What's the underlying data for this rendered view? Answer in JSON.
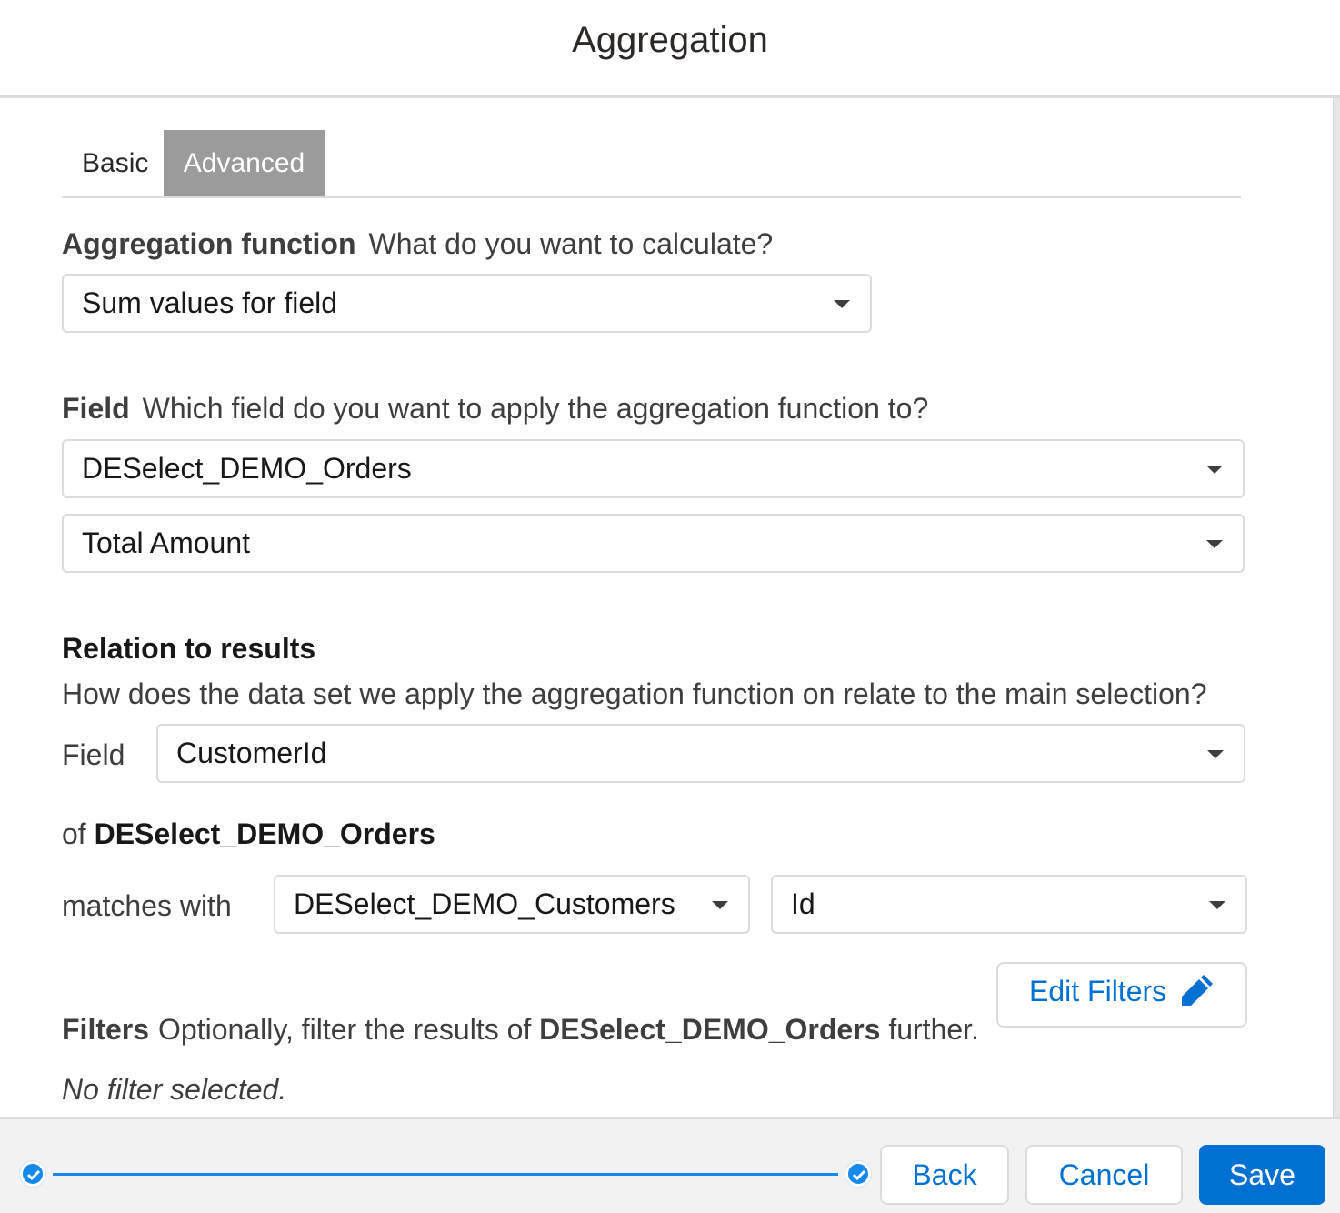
{
  "header": {
    "title": "Aggregation"
  },
  "tabs": [
    {
      "label": "Basic",
      "active": false
    },
    {
      "label": "Advanced",
      "active": true
    }
  ],
  "aggregation_function": {
    "label": "Aggregation function",
    "help": "What do you want to calculate?",
    "selected": "Sum values for field"
  },
  "field": {
    "label": "Field",
    "help": "Which field do you want to apply the aggregation function to?",
    "data_extension": "DESelect_DEMO_Orders",
    "field_name": "Total Amount"
  },
  "relation": {
    "title": "Relation to results",
    "help": "How does the data set we apply the aggregation function on relate to the main selection?",
    "field_label": "Field",
    "field_value": "CustomerId",
    "of_prefix": "of",
    "of_name": "DESelect_DEMO_Orders",
    "matches_label": "matches with",
    "match_data_extension": "DESelect_DEMO_Customers",
    "match_field": "Id"
  },
  "filters": {
    "label": "Filters",
    "help_prefix": "Optionally, filter the results of",
    "help_name": "DESelect_DEMO_Orders",
    "help_suffix": "further.",
    "status": "No filter selected.",
    "edit_label": "Edit Filters"
  },
  "footer": {
    "back_label": "Back",
    "cancel_label": "Cancel",
    "save_label": "Save",
    "progress_fraction": 1.0
  },
  "colors": {
    "brand": "#0070d2",
    "progress": "#1589ee",
    "active_tab": "#9b9b9b"
  }
}
